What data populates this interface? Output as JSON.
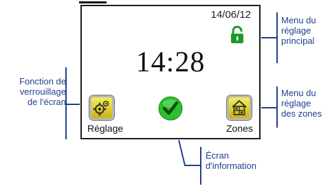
{
  "screen": {
    "date": "14/06/12",
    "time": "14:28",
    "setup_label": "Réglage",
    "zones_label": "Zones",
    "icons": [
      "lock-icon",
      "gear-icon",
      "checkmark-icon",
      "house-zones-icon"
    ]
  },
  "callouts": {
    "screen_lock": [
      "Fonction de",
      "verrouillage",
      "de l'écran"
    ],
    "main_settings_menu": [
      "Menu du",
      "réglage",
      "principal"
    ],
    "zone_settings_menu": [
      "Menu du",
      "réglage",
      "des zones"
    ],
    "information_screen": [
      "Écran",
      "d'information"
    ]
  },
  "colors": {
    "callout_text": "#1f3f8f",
    "lock_green": "#1f9a2a",
    "check_green": "#2cbf2c",
    "tile_yellow": "#e9d92a"
  }
}
